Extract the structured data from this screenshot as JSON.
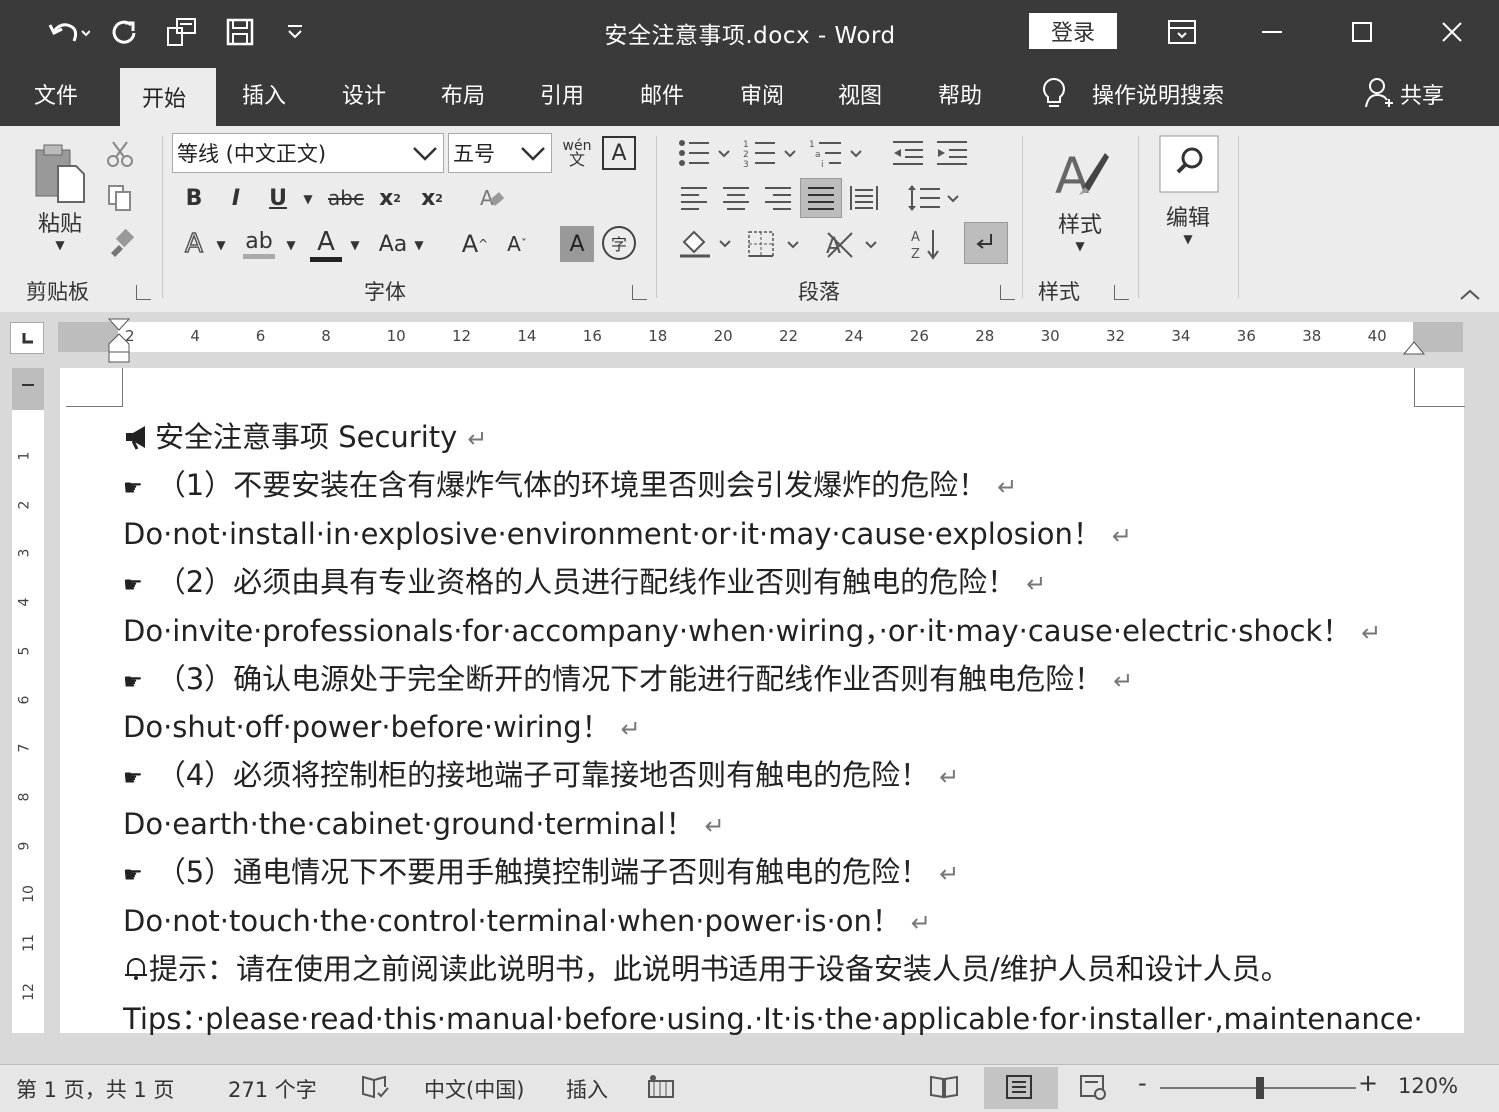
{
  "window": {
    "title": "安全注意事项.docx  -  Word",
    "login_label": "登录"
  },
  "tabs": [
    "文件",
    "开始",
    "插入",
    "设计",
    "布局",
    "引用",
    "邮件",
    "审阅",
    "视图",
    "帮助"
  ],
  "active_tab": "开始",
  "tell_me": "操作说明搜索",
  "share_label": "共享",
  "ribbon": {
    "clipboard": {
      "paste_label": "粘贴",
      "group_label": "剪贴板"
    },
    "font": {
      "font_name": "等线 (中文正文)",
      "font_size": "五号",
      "group_label": "字体",
      "bold": "B",
      "italic": "I",
      "underline": "U",
      "strike": "abc",
      "sub": "x",
      "sup": "x",
      "change_case": "Aa",
      "grow": "A",
      "shrink": "A",
      "text_effects": "A",
      "highlight": "ab",
      "font_color": "A",
      "char_shading": "A",
      "enclose": "字",
      "phonetic_top": "wén",
      "phonetic_bottom": "文",
      "border_char": "A"
    },
    "paragraph": {
      "group_label": "段落"
    },
    "styles": {
      "label": "样式",
      "group_label": "样式"
    },
    "editing": {
      "label": "编辑"
    }
  },
  "ruler": {
    "h_numbers": [
      "2",
      "4",
      "6",
      "8",
      "10",
      "12",
      "14",
      "16",
      "18",
      "20",
      "22",
      "24",
      "26",
      "28",
      "30",
      "32",
      "34",
      "36",
      "38",
      "40"
    ],
    "v_numbers": [
      "1",
      "2",
      "3",
      "4",
      "5",
      "6",
      "7",
      "8",
      "9",
      "10",
      "11",
      "12"
    ]
  },
  "document": {
    "heading": "安全注意事项 Security",
    "items": [
      {
        "zh": "（1）不要安装在含有爆炸气体的环境里否则会引发爆炸的危险！",
        "en": "Do·not·install·in·explosive·environment·or·it·may·cause·explosion！"
      },
      {
        "zh": "（2）必须由具有专业资格的人员进行配线作业否则有触电的危险！",
        "en": "Do·invite·professionals·for·accompany·when·wiring，·or·it·may·cause·electric·shock！"
      },
      {
        "zh": "（3）确认电源处于完全断开的情况下才能进行配线作业否则有触电危险！",
        "en": "Do·shut·off·power·before·wiring！"
      },
      {
        "zh": "（4）必须将控制柜的接地端子可靠接地否则有触电的危险！",
        "en": "Do·earth·the·cabinet·ground·terminal！"
      },
      {
        "zh": "（5）通电情况下不要用手触摸控制端子否则有触电的危险！",
        "en": "Do·not·touch·the·control·terminal·when·power·is·on！"
      }
    ],
    "tip_zh": "提示：请在使用之前阅读此说明书，此说明书适用于设备安装人员/维护人员和设计人员。",
    "tip_en": "Tips：·please·read·this·manual·before·using.·It·is·the·applicable·for·installer·,maintenance·–man·",
    "return_mark": "↵"
  },
  "status": {
    "page": "第 1 页，共 1 页",
    "words": "271 个字",
    "language": "中文(中国)",
    "mode": "插入",
    "zoom": "120%",
    "zoom_minus": "-",
    "zoom_plus": "+"
  }
}
